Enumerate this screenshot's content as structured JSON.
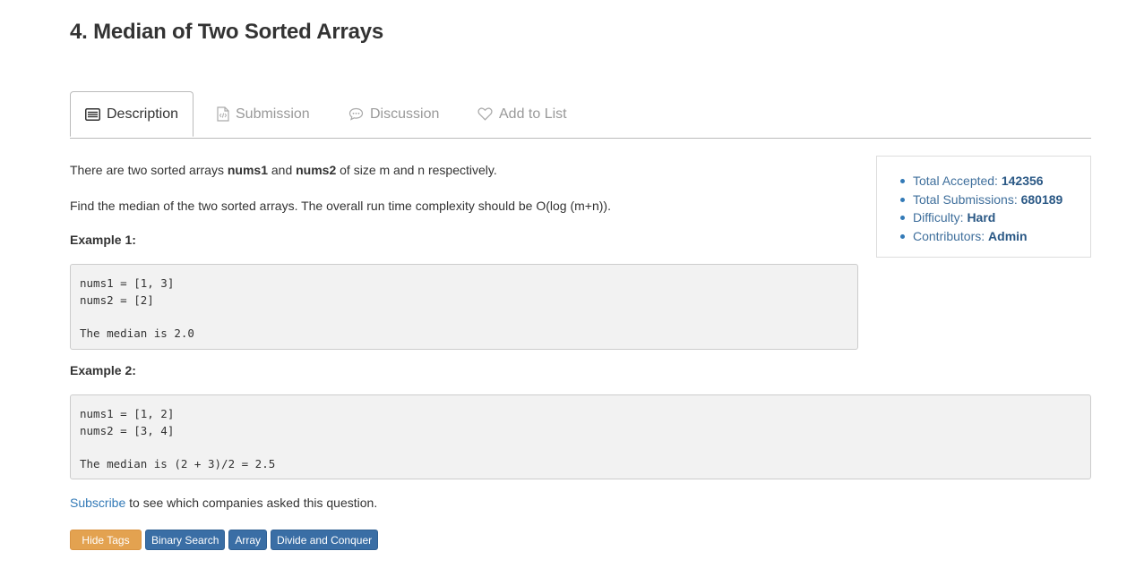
{
  "problem": {
    "title": "4. Median of Two Sorted Arrays"
  },
  "tabs": [
    {
      "label": "Description",
      "icon": "list-icon",
      "active": true
    },
    {
      "label": "Submission",
      "icon": "code-file-icon",
      "active": false
    },
    {
      "label": "Discussion",
      "icon": "speech-bubble-icon",
      "active": false
    },
    {
      "label": "Add to List",
      "icon": "heart-icon",
      "active": false
    }
  ],
  "description": {
    "p1_prefix": "There are two sorted arrays ",
    "p1_var1": "nums1",
    "p1_mid": " and ",
    "p1_var2": "nums2",
    "p1_suffix": " of size m and n respectively.",
    "p2": "Find the median of the two sorted arrays. The overall run time complexity should be O(log (m+n)).",
    "example1_label": "Example 1:",
    "example1_code": "nums1 = [1, 3]\nnums2 = [2]\n\nThe median is 2.0",
    "example2_label": "Example 2:",
    "example2_code": "nums1 = [1, 2]\nnums2 = [3, 4]\n\nThe median is (2 + 3)/2 = 2.5",
    "subscribe_link": "Subscribe",
    "subscribe_text": " to see which companies asked this question."
  },
  "stats": {
    "accepted_label": "Total Accepted: ",
    "accepted_value": "142356",
    "submissions_label": "Total Submissions: ",
    "submissions_value": "680189",
    "difficulty_label": "Difficulty: ",
    "difficulty_value": "Hard",
    "contributors_label": "Contributors: ",
    "contributors_value": "Admin"
  },
  "tags": {
    "hide_label": "Hide Tags",
    "items": [
      "Binary Search",
      "Array",
      "Divide and Conquer"
    ]
  },
  "colors": {
    "accent_blue": "#337ab7",
    "tag_blue": "#3a6ea5",
    "hide_tag_orange": "#e3a250"
  }
}
